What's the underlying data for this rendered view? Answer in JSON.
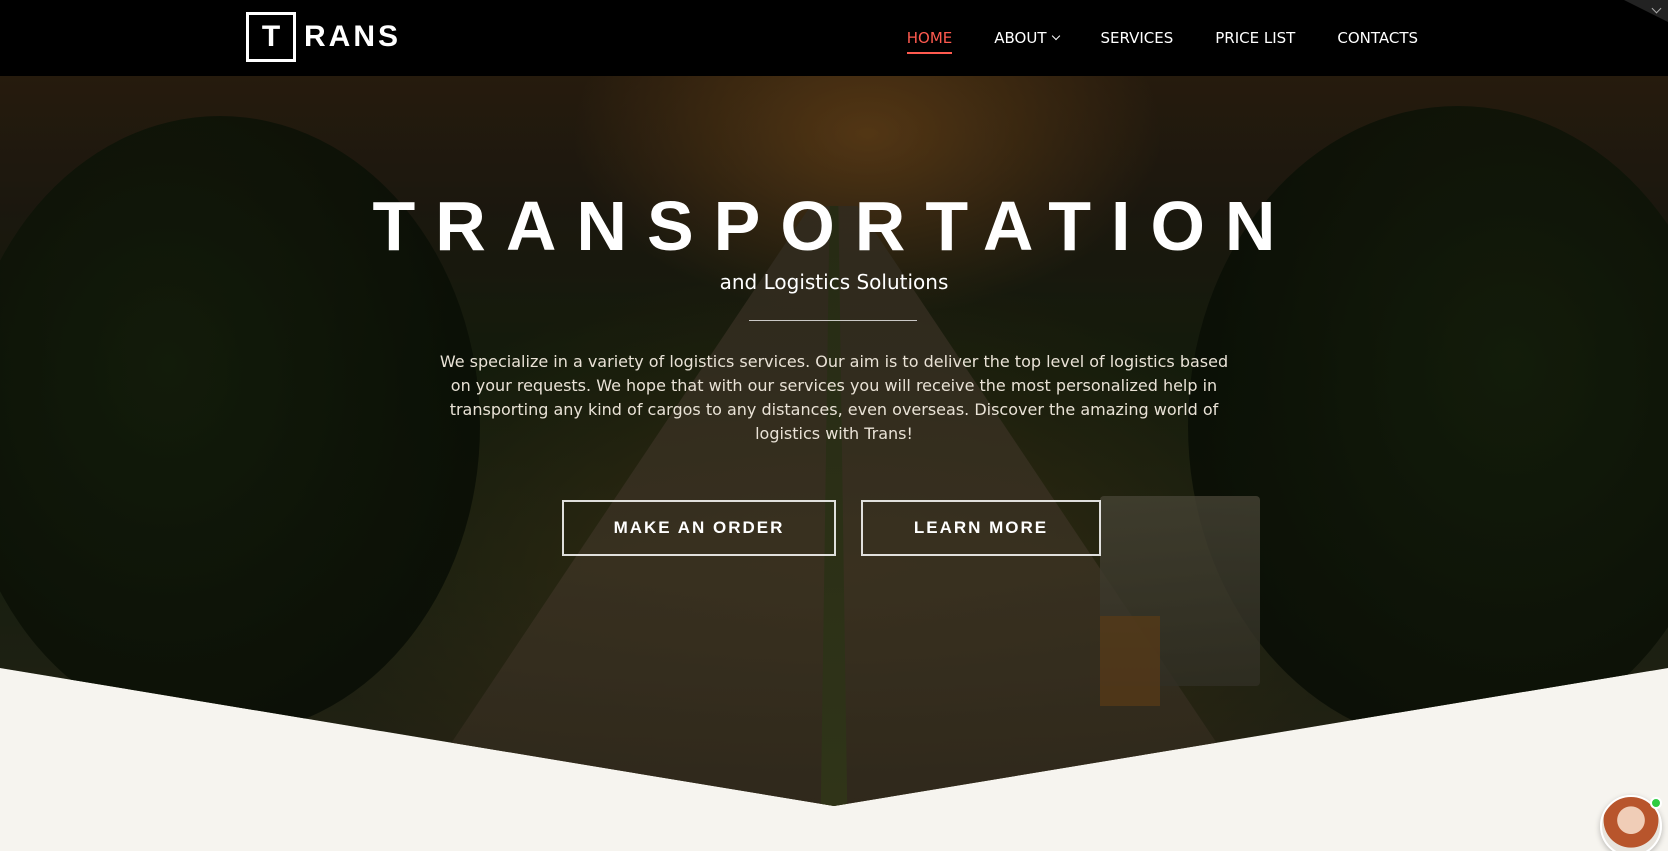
{
  "brand": {
    "logo_letter": "T",
    "logo_rest": "RANS"
  },
  "nav": {
    "items": [
      {
        "label": "HOME",
        "active": true
      },
      {
        "label": "ABOUT",
        "has_dropdown": true
      },
      {
        "label": "SERVICES"
      },
      {
        "label": "PRICE LIST"
      },
      {
        "label": "CONTACTS"
      }
    ]
  },
  "hero": {
    "title": "TRANSPORTATION",
    "subtitle": "and Logistics Solutions",
    "description": "We specialize in a variety of logistics services. Our aim is to deliver the top level of logistics based on your requests. We hope that with our services you will receive the most personalized help in transporting any kind of cargos to any distances, even overseas. Discover the amazing world of logistics with Trans!",
    "buttons": {
      "order": "MAKE AN ORDER",
      "learn": "LEARN MORE"
    }
  },
  "colors": {
    "accent": "#ff5a4f",
    "header_bg": "#000000",
    "page_bg": "#f6f4ef",
    "online": "#2ecc40"
  },
  "icons": {
    "dropdown": "chevron-down-icon",
    "corner": "chevron-down-icon",
    "chat": "support-avatar",
    "status": "online-status-dot"
  }
}
